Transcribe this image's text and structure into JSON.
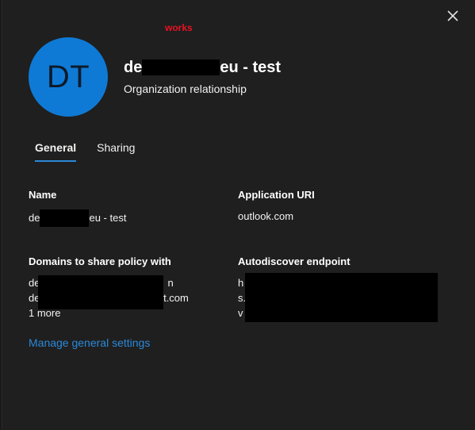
{
  "annotation": "works",
  "header": {
    "avatar_initials": "DT",
    "title_prefix": "de",
    "title_suffix": "eu - test",
    "subtitle": "Organization relationship"
  },
  "tabs": [
    {
      "label": "General",
      "active": true
    },
    {
      "label": "Sharing",
      "active": false
    }
  ],
  "fields": {
    "name": {
      "label": "Name",
      "value_prefix": "de",
      "value_suffix": "eu - test"
    },
    "application_uri": {
      "label": "Application URI",
      "value": "outlook.com"
    },
    "domains": {
      "label": "Domains to share policy with",
      "line1_prefix": "de",
      "line1_suffix": "n",
      "line2_prefix": "de",
      "line2_suffix": "ft.com",
      "more": "1 more"
    },
    "autodiscover": {
      "label": "Autodiscover endpoint",
      "line1": "h",
      "line2": "s.",
      "line3": "v"
    }
  },
  "manage_link": "Manage general settings",
  "colors": {
    "background": "#1f1f1f",
    "avatar": "#0f7ad6",
    "accent": "#2b88d8",
    "annotation": "#e81123"
  }
}
